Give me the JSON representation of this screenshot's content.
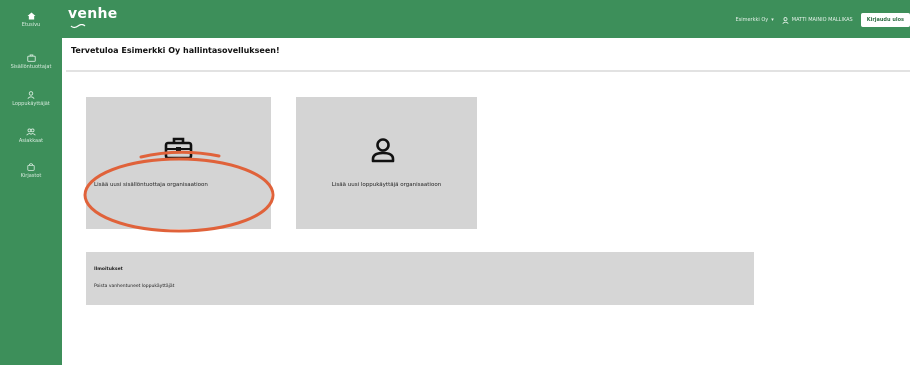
{
  "colors": {
    "brand": "#3d8f5a",
    "card": "#d4d4d4",
    "annotation": "#e0623a"
  },
  "sidebar": {
    "items": [
      {
        "icon": "home-icon",
        "label": "Etusivu"
      },
      {
        "icon": "briefcase-icon",
        "label": "Sisällöntuottajat"
      },
      {
        "icon": "person-icon",
        "label": "Loppukäyttäjät"
      },
      {
        "icon": "people-icon",
        "label": "Asiakkaat"
      },
      {
        "icon": "bag-icon",
        "label": "Kirjastot"
      }
    ]
  },
  "header": {
    "logo": "venhe",
    "org_select": "Esimerkki Oy",
    "user_name": "MATTI MAINIO MALLIKAS",
    "logout_label": "Kirjaudu ulos"
  },
  "main": {
    "title": "Tervetuloa Esimerkki Oy hallintasovellukseen!",
    "cards": [
      {
        "icon": "briefcase-icon",
        "label": "Lisää uusi sisällöntuottaja organisaatioon"
      },
      {
        "icon": "user-icon",
        "label": "Lisää uusi loppukäyttäjä organisaatioon"
      }
    ],
    "info": {
      "heading": "Ilmoitukset",
      "text": "Poista vanhentuneet loppukäyttäjät"
    }
  }
}
